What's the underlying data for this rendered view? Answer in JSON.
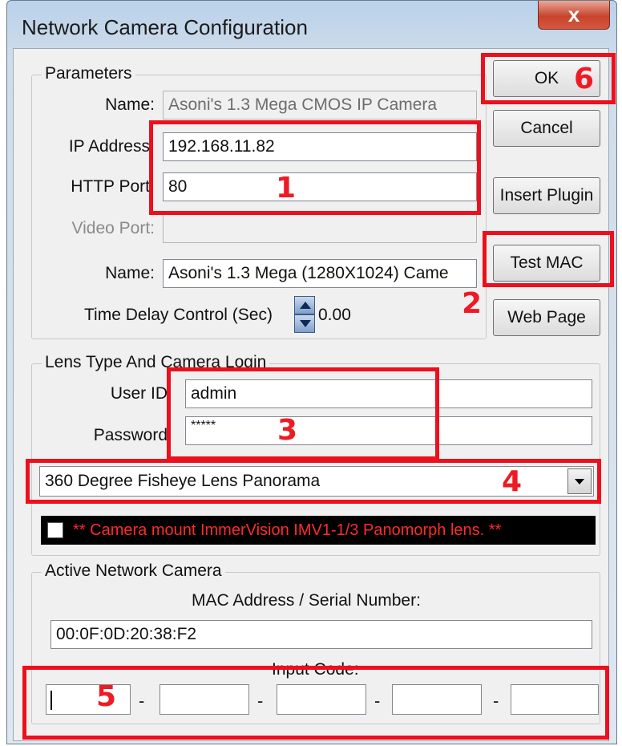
{
  "window": {
    "title": "Network Camera Configuration",
    "close_label": "x"
  },
  "parameters": {
    "legend": "Parameters",
    "name_label": "Name:",
    "name_value": "Asoni's 1.3 Mega CMOS IP Camera",
    "ip_label": "IP Address",
    "ip_value": "192.168.11.82",
    "http_port_label": "HTTP Port",
    "http_port_value": "80",
    "video_port_label": "Video Port:",
    "video_port_value": "",
    "name2_label": "Name:",
    "name2_value": "Asoni's 1.3 Mega (1280X1024) Came",
    "delay_label": "Time Delay Control (Sec)",
    "delay_value": "0.00"
  },
  "buttons": {
    "ok": "OK",
    "cancel": "Cancel",
    "insert_plugin": "Insert Plugin",
    "test_mac": "Test MAC",
    "web_page": "Web Page"
  },
  "login": {
    "legend": "Lens Type And Camera Login",
    "user_label": "User ID",
    "user_value": "admin",
    "password_label": "Password",
    "password_value": "*****",
    "lens_selected": "360 Degree Fisheye Lens Panorama",
    "immervision_text": "** Camera mount ImmerVision IMV1-1/3 Panomorph lens. **"
  },
  "active": {
    "legend": "Active Network Camera",
    "mac_label": "MAC Address / Serial Number:",
    "mac_value": "00:0F:0D:20:38:F2",
    "input_code_label": "Input Code:",
    "codes": [
      "",
      "",
      "",
      "",
      ""
    ],
    "separator": "-"
  },
  "annotations": {
    "n1": "1",
    "n2": "2",
    "n3": "3",
    "n4": "4",
    "n5": "5",
    "n6": "6",
    "color": "#ee1b24"
  }
}
